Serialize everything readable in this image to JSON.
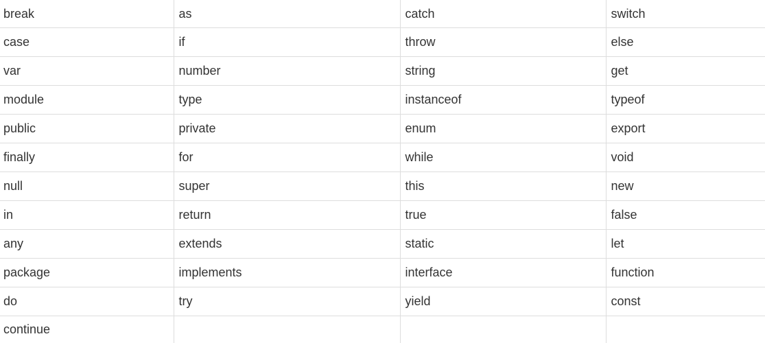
{
  "keywords_table": {
    "rows": [
      [
        "break",
        "as",
        "catch",
        "switch"
      ],
      [
        "case",
        "if",
        "throw",
        "else"
      ],
      [
        "var",
        "number",
        "string",
        "get"
      ],
      [
        "module",
        "type",
        "instanceof",
        "typeof"
      ],
      [
        "public",
        "private",
        "enum",
        "export"
      ],
      [
        "finally",
        "for",
        "while",
        "void"
      ],
      [
        "null",
        "super",
        "this",
        "new"
      ],
      [
        "in",
        "return",
        "true",
        "false"
      ],
      [
        "any",
        "extends",
        "static",
        "let"
      ],
      [
        "package",
        "implements",
        "interface",
        "function"
      ],
      [
        "do",
        "try",
        "yield",
        "const"
      ],
      [
        "continue",
        "",
        "",
        ""
      ]
    ]
  }
}
